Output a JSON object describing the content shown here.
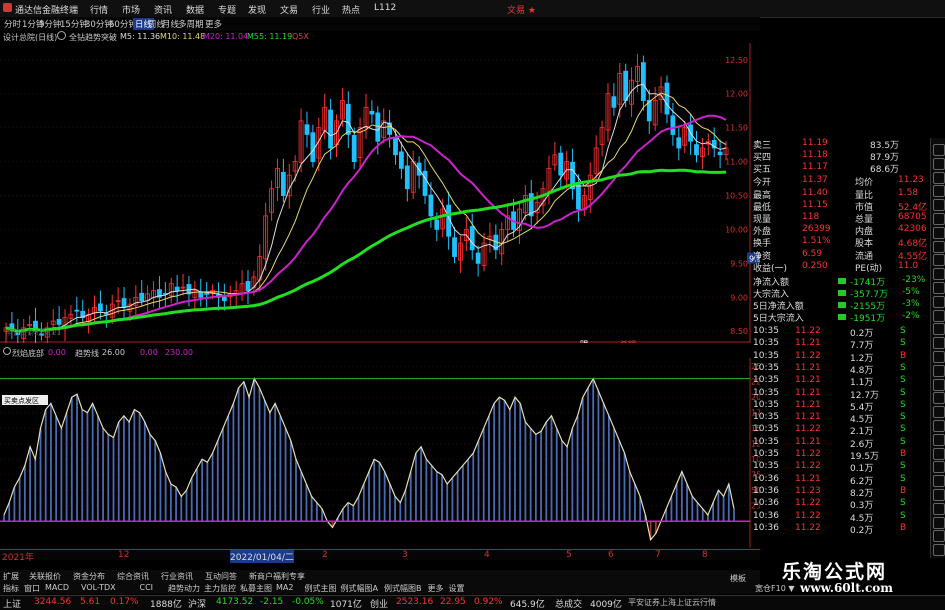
{
  "titlebar": {
    "title": "通达信金融终端",
    "menus": [
      "行情",
      "市场",
      "资讯",
      "数据",
      "专题",
      "发现",
      "文易",
      "行业",
      "热点",
      "L112"
    ],
    "right": "文易 ★"
  },
  "toolbar": {
    "items": [
      "分时",
      "1分钟",
      "5分钟",
      "15分钟",
      "30分钟",
      "60分钟",
      "日线",
      "周线",
      "月线",
      "多周期",
      "更多"
    ],
    "active": "日线"
  },
  "info": {
    "stock": "设计总院(日线)",
    "indicator": "全钻趋势突破",
    "ma5": "M5: 11.36",
    "ma10": "M10: 11.48",
    "ma20": "M20: 11.04",
    "ma55": "M55: 11.19",
    "extra": "Q5X"
  },
  "chart_main": {
    "yticks": [
      "12.50",
      "12.00",
      "11.50",
      "11.00",
      "10.50",
      "10.00",
      "9.50",
      "9.00",
      "8.50"
    ],
    "ylim": [
      8.4,
      12.6
    ],
    "closes": [
      8.55,
      8.5,
      8.45,
      8.55,
      8.6,
      8.5,
      8.45,
      8.55,
      8.65,
      8.6,
      8.7,
      8.75,
      8.8,
      8.7,
      8.75,
      8.85,
      8.8,
      8.75,
      8.9,
      8.95,
      8.85,
      8.9,
      9.0,
      8.95,
      9.05,
      9.1,
      9.0,
      9.05,
      9.2,
      9.1,
      9.15,
      9.05,
      9.1,
      9.0,
      9.05,
      9.1,
      9.0,
      8.95,
      9.05,
      9.1,
      9.2,
      9.1,
      9.3,
      9.6,
      10.2,
      10.6,
      10.9,
      10.5,
      10.8,
      11.0,
      11.6,
      11.4,
      11.0,
      11.5,
      11.8,
      11.2,
      11.6,
      11.9,
      11.4,
      11.0,
      11.5,
      11.8,
      11.7,
      11.3,
      11.6,
      11.4,
      11.1,
      10.9,
      10.6,
      11.0,
      10.8,
      10.5,
      10.2,
      10.0,
      10.3,
      9.9,
      9.6,
      9.8,
      10.0,
      9.7,
      9.5,
      9.8,
      9.9,
      9.7,
      10.0,
      10.2,
      10.0,
      10.3,
      10.5,
      10.2,
      10.4,
      10.6,
      10.9,
      11.1,
      10.8,
      11.0,
      10.6,
      10.3,
      10.5,
      10.8,
      11.2,
      11.5,
      12.0,
      11.8,
      12.3,
      11.9,
      12.2,
      12.4,
      11.9,
      11.6,
      11.9,
      12.1,
      11.7,
      11.4,
      11.2,
      11.5,
      11.3,
      11.1,
      11.2,
      11.3,
      11.2,
      11.1,
      11.2
    ],
    "labels": [
      "明",
      "杀耀"
    ],
    "price_tag": "9.57",
    "wm": "明日头条8月8.21"
  },
  "sub": {
    "title": "烈焰底部",
    "v1": "0.00",
    "name2": "趋势线",
    "v2": "26.00",
    "v3": "0.00",
    "v4": "230.00",
    "tag": "买卖点发区",
    "yticks": [
      "250.0",
      "225.0",
      "200.0",
      "175.0",
      "150.0",
      "125.0",
      "100.0",
      "75.0",
      "50.0",
      "25.0"
    ],
    "values": [
      10,
      30,
      55,
      70,
      90,
      120,
      100,
      150,
      180,
      190,
      170,
      150,
      175,
      200,
      205,
      180,
      175,
      190,
      170,
      150,
      140,
      135,
      160,
      170,
      160,
      180,
      175,
      160,
      140,
      130,
      110,
      80,
      60,
      55,
      40,
      50,
      70,
      85,
      100,
      95,
      110,
      130,
      150,
      170,
      190,
      215,
      225,
      200,
      230,
      215,
      195,
      175,
      190,
      170,
      150,
      130,
      100,
      80,
      60,
      40,
      30,
      20,
      0,
      -10,
      5,
      20,
      30,
      25,
      40,
      60,
      80,
      100,
      95,
      80,
      60,
      40,
      30,
      50,
      80,
      110,
      120,
      100,
      90,
      80,
      75,
      60,
      70,
      80,
      90,
      100,
      110,
      130,
      150,
      170,
      190,
      200,
      195,
      180,
      200,
      190,
      160,
      150,
      140,
      145,
      160,
      170,
      150,
      130,
      120,
      150,
      170,
      200,
      215,
      230,
      210,
      190,
      170,
      150,
      130,
      110,
      80,
      60,
      40,
      10,
      -30,
      -20,
      0,
      20,
      40,
      60,
      80,
      60,
      40,
      30,
      20,
      10,
      30,
      50,
      40,
      60,
      20
    ],
    "ylim": [
      -40,
      260
    ],
    "ref_high": 230,
    "ref_low": 0
  },
  "xaxis": {
    "labels": [
      "2021年",
      "12",
      "2022/01/04/二",
      "2",
      "3",
      "4",
      "5",
      "6",
      "7",
      "8"
    ]
  },
  "rpanel": {
    "top": [
      {
        "l": "卖三",
        "v": "11.19",
        "n": "83.5万"
      },
      {
        "l": "买四",
        "v": "11.18",
        "n": "87.9万"
      },
      {
        "l": "买五",
        "v": "11.17",
        "n": "68.6万"
      },
      {
        "l": "今开",
        "v": "11.37",
        "l2": "均价",
        "v2": "11.23"
      },
      {
        "l": "最高",
        "v": "11.40",
        "l2": "量比",
        "v2": "1.58"
      },
      {
        "l": "最低",
        "v": "11.15",
        "l2": "市值",
        "v2": "52.4亿"
      },
      {
        "l": "现量",
        "v": "118",
        "l2": "总量",
        "v2": "68705"
      },
      {
        "l": "外盘",
        "v": "26399",
        "l2": "内盘",
        "v2": "42306"
      },
      {
        "l": "换手",
        "v": "1.51%",
        "l2": "股本",
        "v2": "4.68亿"
      },
      {
        "l": "净资",
        "v": "6.59",
        "l2": "流通",
        "v2": "4.55亿"
      },
      {
        "l": "收益(一)",
        "v": "0.250",
        "l2": "PE(动)",
        "v2": "11.0"
      }
    ],
    "flows": [
      {
        "l": "净流入额",
        "v": "-1741万",
        "p": "-23%"
      },
      {
        "l": "大宗流入",
        "v": "-357.7万",
        "p": "-5%"
      },
      {
        "l": "5日净流入额",
        "v": "-2155万",
        "p": "-3%"
      },
      {
        "l": "5日大宗流入",
        "v": "-1951万",
        "p": "-2%"
      }
    ],
    "ticks": [
      [
        "10:35",
        "11.22",
        "0.2万",
        "S"
      ],
      [
        "10:35",
        "11.21",
        "7.7万",
        "S"
      ],
      [
        "10:35",
        "11.22",
        "1.2万",
        "B"
      ],
      [
        "10:35",
        "11.21",
        "4.8万",
        "S"
      ],
      [
        "10:35",
        "11.21",
        "1.1万",
        "S"
      ],
      [
        "10:35",
        "11.21",
        "12.7万",
        "S"
      ],
      [
        "10:35",
        "11.21",
        "5.4万",
        "S"
      ],
      [
        "10:35",
        "11.21",
        "4.5万",
        "S"
      ],
      [
        "10:35",
        "11.22",
        "2.1万",
        "S"
      ],
      [
        "10:35",
        "11.21",
        "2.6万",
        "S"
      ],
      [
        "10:35",
        "11.22",
        "19.5万",
        "B"
      ],
      [
        "10:35",
        "11.22",
        "0.1万",
        "S"
      ],
      [
        "10:36",
        "11.21",
        "6.2万",
        "S"
      ],
      [
        "10:36",
        "11.23",
        "8.2万",
        "B"
      ],
      [
        "10:36",
        "11.22",
        "0.3万",
        "S"
      ],
      [
        "10:36",
        "11.22",
        "4.5万",
        "S"
      ],
      [
        "10:36",
        "11.22",
        "0.2万",
        "B"
      ]
    ]
  },
  "tabs": {
    "row1": [
      "扩展",
      "关联报价",
      "资金分布",
      "综合资讯",
      "行业资讯",
      "互动问答",
      "新商户福利专享"
    ],
    "row1_right": "宽仓F10 ▼",
    "row2": [
      "指标",
      "窗口",
      "MACD",
      "VOL-TDX",
      "CCI",
      "趋势动力",
      "主力监控",
      "私募主图",
      "MA2",
      "例式主图",
      "例式幅图A",
      "例式幅图B",
      "更多",
      "设置"
    ],
    "row2_right": "模板"
  },
  "status": {
    "sh_label": "上证",
    "sh_val": "3244.56",
    "sh_chg": "5.61",
    "sh_pct": "0.17%",
    "sh_amt": "1888亿",
    "sz_label": "沪深",
    "sz_val": "4173.52",
    "sz_chg": "-2.15",
    "sz_pct": "-0.05%",
    "sz_amt": "1071亿",
    "cy_label": "创业",
    "cy_val": "2523.16",
    "cy_chg": "22.95",
    "cy_pct": "0.92%",
    "cy_amt": "645.9亿",
    "tot_label": "总成交",
    "tot_val": "4009亿",
    "broker": "平安证券上海上证云行情"
  },
  "watermark": {
    "title": "乐淘公式网",
    "url": "www.60lt.com"
  },
  "colors": {
    "up": "#ff3030",
    "down": "#20c0ff",
    "ma_green": "#22dd22",
    "ma_purple": "#cc22cc",
    "ma_yellow": "#e6d96a",
    "ma_white": "#dddddd"
  }
}
